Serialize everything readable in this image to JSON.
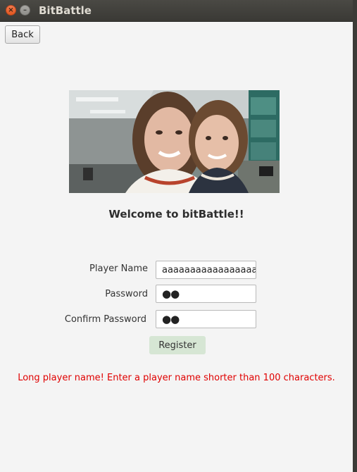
{
  "window": {
    "title": "BitBattle",
    "close_glyph": "×",
    "minimize_glyph": "–"
  },
  "toolbar": {
    "back_label": "Back"
  },
  "main": {
    "welcome_text": "Welcome to bitBattle!!",
    "photo_icon": "selfie-photo"
  },
  "form": {
    "player_name_label": "Player Name",
    "player_name_value": "aaaaaaaaaaaaaaaaa",
    "password_label": "Password",
    "password_value": "●●",
    "confirm_password_label": "Confirm Password",
    "confirm_password_value": "●●",
    "register_label": "Register"
  },
  "status": {
    "error_message": "Long player name! Enter a player name shorter than 100 characters.",
    "error_color": "#e00000"
  }
}
